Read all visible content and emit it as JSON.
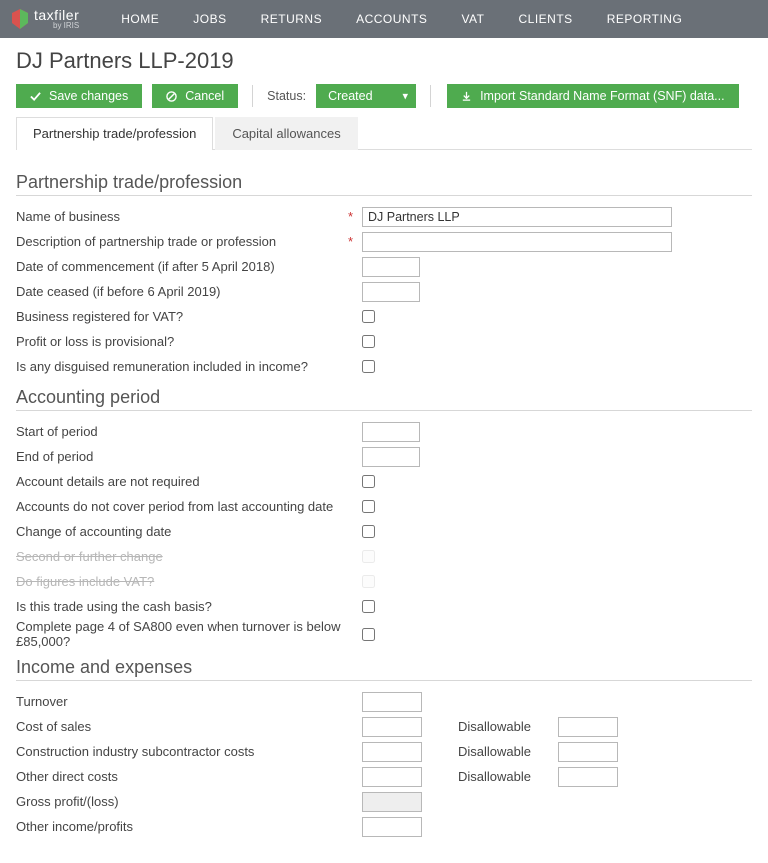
{
  "brand": {
    "name": "taxfiler",
    "byline": "by IRIS"
  },
  "nav": [
    "HOME",
    "JOBS",
    "RETURNS",
    "ACCOUNTS",
    "VAT",
    "CLIENTS",
    "REPORTING"
  ],
  "page_title": "DJ Partners LLP-2019",
  "actions": {
    "save": "Save changes",
    "cancel": "Cancel",
    "status_label": "Status:",
    "status_value": "Created",
    "import": "Import Standard Name Format (SNF) data..."
  },
  "tabs": [
    {
      "label": "Partnership trade/profession",
      "active": true
    },
    {
      "label": "Capital allowances",
      "active": false
    }
  ],
  "sections": {
    "s1": {
      "title": "Partnership trade/profession",
      "fields": {
        "name_label": "Name of business",
        "name_value": "DJ Partners LLP",
        "desc_label": "Description of partnership trade or profession",
        "desc_value": "",
        "comm_label": "Date of commencement (if after 5 April 2018)",
        "comm_value": "",
        "cease_label": "Date ceased (if before 6 April 2019)",
        "cease_value": "",
        "vat_label": "Business registered for VAT?",
        "prov_label": "Profit or loss is provisional?",
        "disg_label": "Is any disguised remuneration included in income?"
      }
    },
    "s2": {
      "title": "Accounting period",
      "fields": {
        "start_label": "Start of period",
        "start_value": "",
        "end_label": "End of period",
        "end_value": "",
        "noacct_label": "Account details are not required",
        "notcover_label": "Accounts do not cover period from last accounting date",
        "change_label": "Change of accounting date",
        "second_label": "Second or further change",
        "figvat_label": "Do figures include VAT?",
        "cash_label": "Is this trade using the cash basis?",
        "p4_label": "Complete page 4 of SA800 even when turnover is below £85,000?"
      }
    },
    "s3": {
      "title": "Income and expenses",
      "disallow_label": "Disallowable",
      "fields": {
        "turnover_label": "Turnover",
        "cos_label": "Cost of sales",
        "cis_label": "Construction industry subcontractor costs",
        "odc_label": "Other direct costs",
        "gross_label": "Gross profit/(loss)",
        "other_label": "Other income/profits"
      }
    }
  }
}
